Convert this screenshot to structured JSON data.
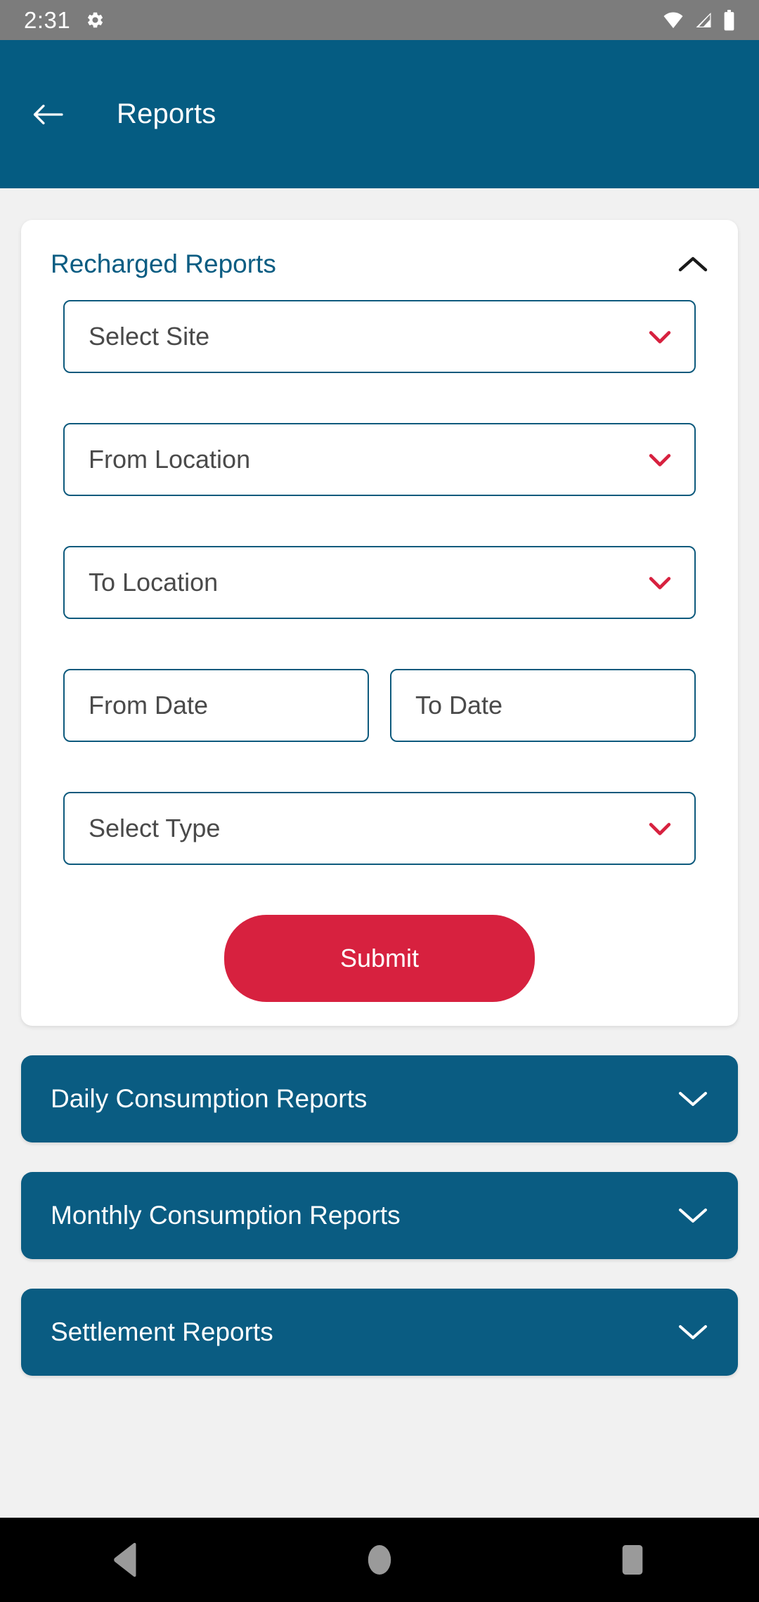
{
  "status_bar": {
    "time": "2:31",
    "icons": [
      "gear-icon",
      "wifi-icon",
      "signal-icon",
      "battery-icon"
    ],
    "background": "#7C7C7C"
  },
  "app_bar": {
    "title": "Reports",
    "back_icon": "arrow-left-icon",
    "background": "#055C82"
  },
  "theme": {
    "primary": "#0A5C82",
    "accent": "#D7213F",
    "field_border": "#0E5A7D",
    "page_background": "#F1F1F1"
  },
  "expanded_section": {
    "title": "Recharged Reports",
    "toggle_icon": "chevron-up-icon",
    "fields": [
      {
        "label": "Select Site",
        "value": "",
        "icon": "chevron-down-icon",
        "type": "select"
      },
      {
        "label": "From Location",
        "value": "",
        "icon": "chevron-down-icon",
        "type": "select"
      },
      {
        "label": "To Location",
        "value": "",
        "icon": "chevron-down-icon",
        "type": "select"
      }
    ],
    "date_fields": [
      {
        "label": "From Date",
        "value": "",
        "type": "date"
      },
      {
        "label": "To Date",
        "value": "",
        "type": "date"
      }
    ],
    "type_field": {
      "label": "Select Type",
      "value": "",
      "icon": "chevron-down-icon",
      "type": "select"
    },
    "submit_label": "Submit"
  },
  "collapsed_sections": [
    {
      "title": "Daily Consumption Reports",
      "toggle_icon": "chevron-down-icon"
    },
    {
      "title": "Monthly Consumption Reports",
      "toggle_icon": "chevron-down-icon"
    },
    {
      "title": "Settlement Reports",
      "toggle_icon": "chevron-down-icon"
    }
  ],
  "nav_bar": {
    "back": "triangle-back-icon",
    "home": "circle-home-icon",
    "recents": "square-recents-icon"
  }
}
